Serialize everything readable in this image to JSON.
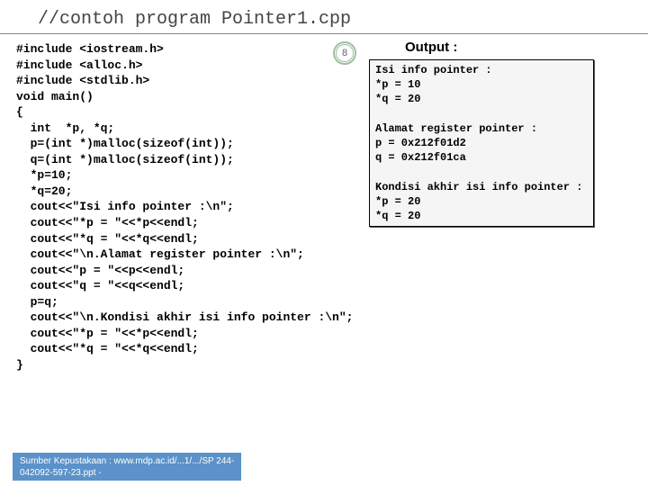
{
  "title": "//contoh program Pointer1.cpp",
  "badge": "8",
  "output_label": "Output :",
  "code": "#include <iostream.h>\n#include <alloc.h>\n#include <stdlib.h>\nvoid main()\n{\n  int  *p, *q;\n  p=(int *)malloc(sizeof(int));\n  q=(int *)malloc(sizeof(int));\n  *p=10;\n  *q=20;\n  cout<<\"Isi info pointer :\\n\";\n  cout<<\"*p = \"<<*p<<endl;\n  cout<<\"*q = \"<<*q<<endl;\n  cout<<\"\\n.Alamat register pointer :\\n\";\n  cout<<\"p = \"<<p<<endl;\n  cout<<\"q = \"<<q<<endl;\n  p=q;\n  cout<<\"\\n.Kondisi akhir isi info pointer :\\n\";\n  cout<<\"*p = \"<<*p<<endl;\n  cout<<\"*q = \"<<*q<<endl;\n}",
  "output": "Isi info pointer :\n*p = 10\n*q = 20\n\nAlamat register pointer :\np = 0x212f01d2\nq = 0x212f01ca\n\nKondisi akhir isi info pointer :\n*p = 20\n*q = 20",
  "footer_line1": "Sumber Kepustakaan : www.mdp.ac.id/...1/.../SP 244-",
  "footer_line2": "042092-597-23.ppt -"
}
